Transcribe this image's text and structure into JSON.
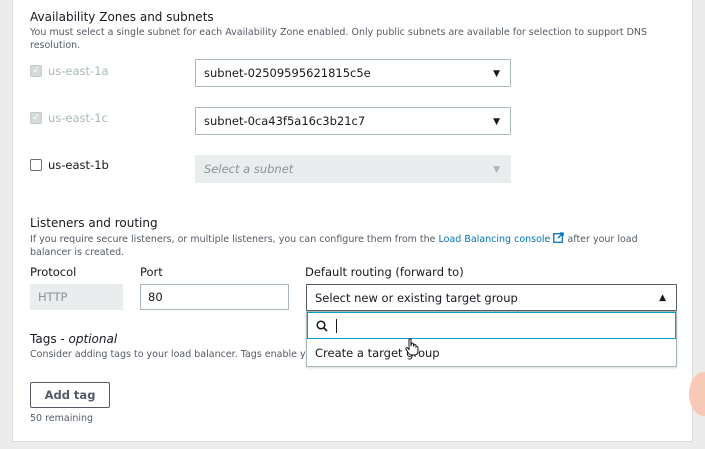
{
  "availability": {
    "title": "Availability Zones and subnets",
    "description": "You must select a single subnet for each Availability Zone enabled. Only public subnets are available for selection to support DNS resolution.",
    "zones": [
      {
        "name": "us-east-1a",
        "checked": true,
        "disabled": true,
        "subnet": "subnet-02509595621815c5e"
      },
      {
        "name": "us-east-1c",
        "checked": true,
        "disabled": true,
        "subnet": "subnet-0ca43f5a16c3b21c7"
      },
      {
        "name": "us-east-1b",
        "checked": false,
        "disabled": false,
        "subnet": "Select a subnet"
      }
    ]
  },
  "listeners": {
    "title": "Listeners and routing",
    "description_pre": "If you require secure listeners, or multiple listeners, you can configure them from the ",
    "link_text": "Load Balancing console",
    "description_post": " after your load balancer is created.",
    "protocol_label": "Protocol",
    "protocol_value": "HTTP",
    "port_label": "Port",
    "port_value": "80",
    "routing_label": "Default routing (forward to)",
    "routing_value": "Select new or existing target group",
    "search_placeholder": "",
    "options": [
      "Create a target group"
    ]
  },
  "tags": {
    "title": "Tags - ",
    "title_optional": "optional",
    "description": "Consider adding tags to your load balancer. Tags enable you",
    "add_label": "Add tag",
    "remaining": "50 remaining"
  },
  "icons": {
    "checkmark": "checkmark-icon",
    "caret_down": "caret-down-icon",
    "caret_up": "caret-up-icon",
    "external": "external-link-icon",
    "search": "search-icon",
    "cursor": "hand-cursor-icon"
  },
  "colors": {
    "link": "#0073bb",
    "focus": "#00a1c9",
    "panel": "#ffffff",
    "background": "#ececec"
  }
}
